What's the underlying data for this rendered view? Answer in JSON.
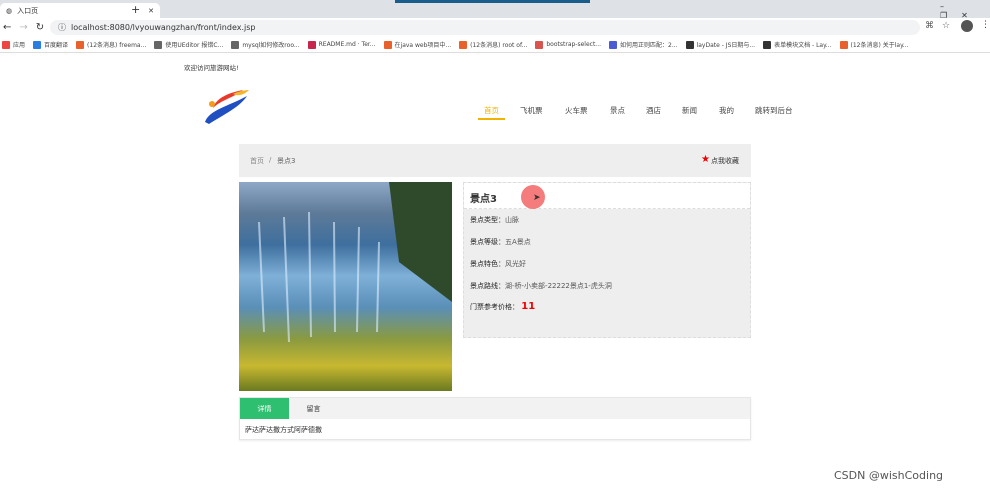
{
  "browser": {
    "tab_title": "入口页",
    "url": "localhost:8080/lvyouwangzhan/front/index.jsp",
    "bookmarks": [
      {
        "label": "应用",
        "color": "#e44"
      },
      {
        "label": "百度翻译",
        "color": "#2a7de1"
      },
      {
        "label": "(12条消息) freema...",
        "color": "#e8612c"
      },
      {
        "label": "使用UEditor 报错C...",
        "color": "#666"
      },
      {
        "label": "mysql如何修改roo...",
        "color": "#666"
      },
      {
        "label": "README.md · Ter...",
        "color": "#c7254e"
      },
      {
        "label": "在java web项目中...",
        "color": "#e8612c"
      },
      {
        "label": "(12条消息) root of...",
        "color": "#e8612c"
      },
      {
        "label": "bootstrap-select...",
        "color": "#d9534f"
      },
      {
        "label": "如何用正则匹配：2...",
        "color": "#4a5bd4"
      },
      {
        "label": "layDate - JS日期与...",
        "color": "#333"
      },
      {
        "label": "表单模块文档 - Lay...",
        "color": "#333"
      },
      {
        "label": "(12条消息) 关于lay...",
        "color": "#e8612c"
      }
    ]
  },
  "welcome": "欢迎访问旅游网站!",
  "nav": [
    {
      "label": "首页",
      "active": true
    },
    {
      "label": "飞机票"
    },
    {
      "label": "火车票"
    },
    {
      "label": "景点"
    },
    {
      "label": "酒店"
    },
    {
      "label": "新闻"
    },
    {
      "label": "我的"
    },
    {
      "label": "跳转到后台"
    }
  ],
  "breadcrumb": {
    "home": "首页",
    "sep": "/",
    "current": "景点3"
  },
  "favorite": "点我收藏",
  "spot": {
    "title": "景点3",
    "fields": [
      {
        "label": "景点类型：",
        "value": "山脉"
      },
      {
        "label": "景点等级：",
        "value": "五A景点"
      },
      {
        "label": "景点特色：",
        "value": "风光好"
      },
      {
        "label": "景点路线：",
        "value": "湖-桥-小卖部-22222景点1-虎头洞"
      }
    ],
    "price_label": "门票参考价格：",
    "price": "11"
  },
  "tabs": [
    {
      "label": "详情",
      "active": true
    },
    {
      "label": "留言"
    }
  ],
  "detail": "萨达萨达撒方式阿萨德撒",
  "watermark": "CSDN @wishCoding",
  "colors": {
    "accent": "#2fbf71",
    "nav_active": "#f0b400",
    "price": "#e00000"
  }
}
